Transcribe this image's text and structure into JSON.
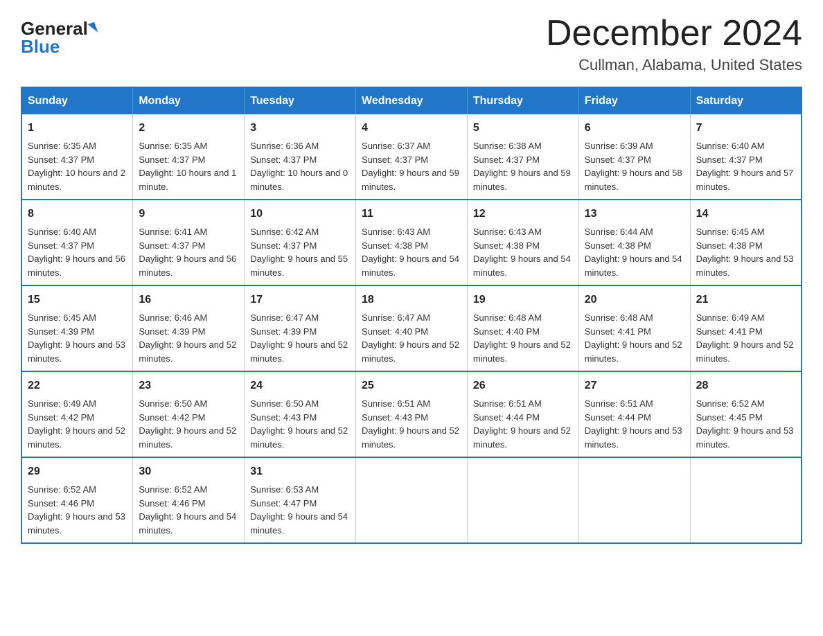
{
  "header": {
    "logo_general": "General",
    "logo_blue": "Blue",
    "title": "December 2024",
    "subtitle": "Cullman, Alabama, United States"
  },
  "weekdays": [
    "Sunday",
    "Monday",
    "Tuesday",
    "Wednesday",
    "Thursday",
    "Friday",
    "Saturday"
  ],
  "weeks": [
    [
      {
        "day": "1",
        "sunrise": "6:35 AM",
        "sunset": "4:37 PM",
        "daylight": "10 hours and 2 minutes."
      },
      {
        "day": "2",
        "sunrise": "6:35 AM",
        "sunset": "4:37 PM",
        "daylight": "10 hours and 1 minute."
      },
      {
        "day": "3",
        "sunrise": "6:36 AM",
        "sunset": "4:37 PM",
        "daylight": "10 hours and 0 minutes."
      },
      {
        "day": "4",
        "sunrise": "6:37 AM",
        "sunset": "4:37 PM",
        "daylight": "9 hours and 59 minutes."
      },
      {
        "day": "5",
        "sunrise": "6:38 AM",
        "sunset": "4:37 PM",
        "daylight": "9 hours and 59 minutes."
      },
      {
        "day": "6",
        "sunrise": "6:39 AM",
        "sunset": "4:37 PM",
        "daylight": "9 hours and 58 minutes."
      },
      {
        "day": "7",
        "sunrise": "6:40 AM",
        "sunset": "4:37 PM",
        "daylight": "9 hours and 57 minutes."
      }
    ],
    [
      {
        "day": "8",
        "sunrise": "6:40 AM",
        "sunset": "4:37 PM",
        "daylight": "9 hours and 56 minutes."
      },
      {
        "day": "9",
        "sunrise": "6:41 AM",
        "sunset": "4:37 PM",
        "daylight": "9 hours and 56 minutes."
      },
      {
        "day": "10",
        "sunrise": "6:42 AM",
        "sunset": "4:37 PM",
        "daylight": "9 hours and 55 minutes."
      },
      {
        "day": "11",
        "sunrise": "6:43 AM",
        "sunset": "4:38 PM",
        "daylight": "9 hours and 54 minutes."
      },
      {
        "day": "12",
        "sunrise": "6:43 AM",
        "sunset": "4:38 PM",
        "daylight": "9 hours and 54 minutes."
      },
      {
        "day": "13",
        "sunrise": "6:44 AM",
        "sunset": "4:38 PM",
        "daylight": "9 hours and 54 minutes."
      },
      {
        "day": "14",
        "sunrise": "6:45 AM",
        "sunset": "4:38 PM",
        "daylight": "9 hours and 53 minutes."
      }
    ],
    [
      {
        "day": "15",
        "sunrise": "6:45 AM",
        "sunset": "4:39 PM",
        "daylight": "9 hours and 53 minutes."
      },
      {
        "day": "16",
        "sunrise": "6:46 AM",
        "sunset": "4:39 PM",
        "daylight": "9 hours and 52 minutes."
      },
      {
        "day": "17",
        "sunrise": "6:47 AM",
        "sunset": "4:39 PM",
        "daylight": "9 hours and 52 minutes."
      },
      {
        "day": "18",
        "sunrise": "6:47 AM",
        "sunset": "4:40 PM",
        "daylight": "9 hours and 52 minutes."
      },
      {
        "day": "19",
        "sunrise": "6:48 AM",
        "sunset": "4:40 PM",
        "daylight": "9 hours and 52 minutes."
      },
      {
        "day": "20",
        "sunrise": "6:48 AM",
        "sunset": "4:41 PM",
        "daylight": "9 hours and 52 minutes."
      },
      {
        "day": "21",
        "sunrise": "6:49 AM",
        "sunset": "4:41 PM",
        "daylight": "9 hours and 52 minutes."
      }
    ],
    [
      {
        "day": "22",
        "sunrise": "6:49 AM",
        "sunset": "4:42 PM",
        "daylight": "9 hours and 52 minutes."
      },
      {
        "day": "23",
        "sunrise": "6:50 AM",
        "sunset": "4:42 PM",
        "daylight": "9 hours and 52 minutes."
      },
      {
        "day": "24",
        "sunrise": "6:50 AM",
        "sunset": "4:43 PM",
        "daylight": "9 hours and 52 minutes."
      },
      {
        "day": "25",
        "sunrise": "6:51 AM",
        "sunset": "4:43 PM",
        "daylight": "9 hours and 52 minutes."
      },
      {
        "day": "26",
        "sunrise": "6:51 AM",
        "sunset": "4:44 PM",
        "daylight": "9 hours and 52 minutes."
      },
      {
        "day": "27",
        "sunrise": "6:51 AM",
        "sunset": "4:44 PM",
        "daylight": "9 hours and 53 minutes."
      },
      {
        "day": "28",
        "sunrise": "6:52 AM",
        "sunset": "4:45 PM",
        "daylight": "9 hours and 53 minutes."
      }
    ],
    [
      {
        "day": "29",
        "sunrise": "6:52 AM",
        "sunset": "4:46 PM",
        "daylight": "9 hours and 53 minutes."
      },
      {
        "day": "30",
        "sunrise": "6:52 AM",
        "sunset": "4:46 PM",
        "daylight": "9 hours and 54 minutes."
      },
      {
        "day": "31",
        "sunrise": "6:53 AM",
        "sunset": "4:47 PM",
        "daylight": "9 hours and 54 minutes."
      },
      null,
      null,
      null,
      null
    ]
  ],
  "labels": {
    "sunrise": "Sunrise:",
    "sunset": "Sunset:",
    "daylight": "Daylight:"
  }
}
